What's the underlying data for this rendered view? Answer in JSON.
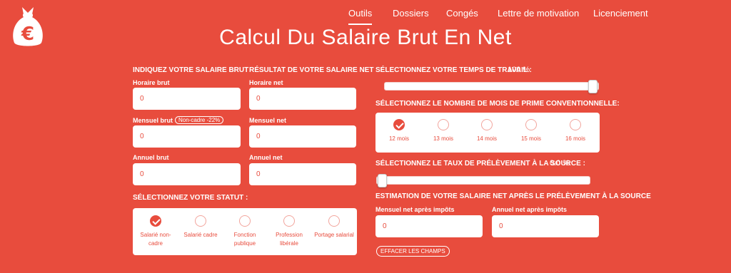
{
  "nav": {
    "items": [
      {
        "label": "Outils"
      },
      {
        "label": "Dossiers"
      },
      {
        "label": "Congés"
      },
      {
        "label": "Lettre de motivation"
      },
      {
        "label": "Licenciement"
      }
    ],
    "active_index": 0
  },
  "page_title": "Calcul Du Salaire Brut En Net",
  "brut": {
    "heading": "INDIQUEZ VOTRE SALAIRE BRUT",
    "horaire_label": "Horaire brut",
    "horaire_value": "0",
    "mensuel_label": "Mensuel brut",
    "mensuel_badge": "Non-cadre -22%",
    "mensuel_value": "0",
    "annuel_label": "Annuel brut",
    "annuel_value": "0"
  },
  "net": {
    "heading": "RÉSULTAT DE VOTRE SALAIRE NET",
    "horaire_label": "Horaire net",
    "horaire_value": "0",
    "mensuel_label": "Mensuel net",
    "mensuel_value": "0",
    "annuel_label": "Annuel net",
    "annuel_value": "0"
  },
  "statut": {
    "heading": "SÉLECTIONNEZ VOTRE STATUT :",
    "options": [
      {
        "line1": "Salarié non-",
        "line2": "cadre",
        "checked": true
      },
      {
        "line1": "Salarié cadre",
        "line2": "",
        "checked": false
      },
      {
        "line1": "Fonction",
        "line2": "publique",
        "checked": false
      },
      {
        "line1": "Profession",
        "line2": "libérale",
        "checked": false
      },
      {
        "line1": "Portage salarial",
        "line2": "",
        "checked": false
      }
    ]
  },
  "temps": {
    "heading": "SÉLECTIONNEZ VOTRE TEMPS DE TRAVAIL :",
    "value_label": "100 %",
    "level_percent": 100
  },
  "prime": {
    "heading": "SÉLECTIONNEZ LE NOMBRE DE MOIS DE PRIME CONVENTIONNELLE:",
    "options": [
      {
        "label": "12 mois",
        "checked": true
      },
      {
        "label": "13 mois",
        "checked": false
      },
      {
        "label": "14 mois",
        "checked": false
      },
      {
        "label": "15 mois",
        "checked": false
      },
      {
        "label": "16 mois",
        "checked": false
      }
    ]
  },
  "prelevement": {
    "heading": "SÉLECTIONNEZ LE TAUX DE PRÉLÈVEMENT À LA SOURCE :",
    "value_label": "0.0 %",
    "level_percent": 0
  },
  "estimation": {
    "heading": "ESTIMATION DE VOTRE SALAIRE NET APRÈS LE PRÉLÈVEMENT À LA SOURCE",
    "mensuel_label": "Mensuel net après impôts",
    "mensuel_value": "0",
    "annuel_label": "Annuel net après impôts",
    "annuel_value": "0"
  },
  "clear_button": "EFFACER LES CHAMPS",
  "colors": {
    "background": "#e84c3d",
    "panel": "#ffffff",
    "accent": "#e84c3d"
  },
  "icons": {
    "logo": "euro-money-bag-icon",
    "check": "check-icon"
  }
}
